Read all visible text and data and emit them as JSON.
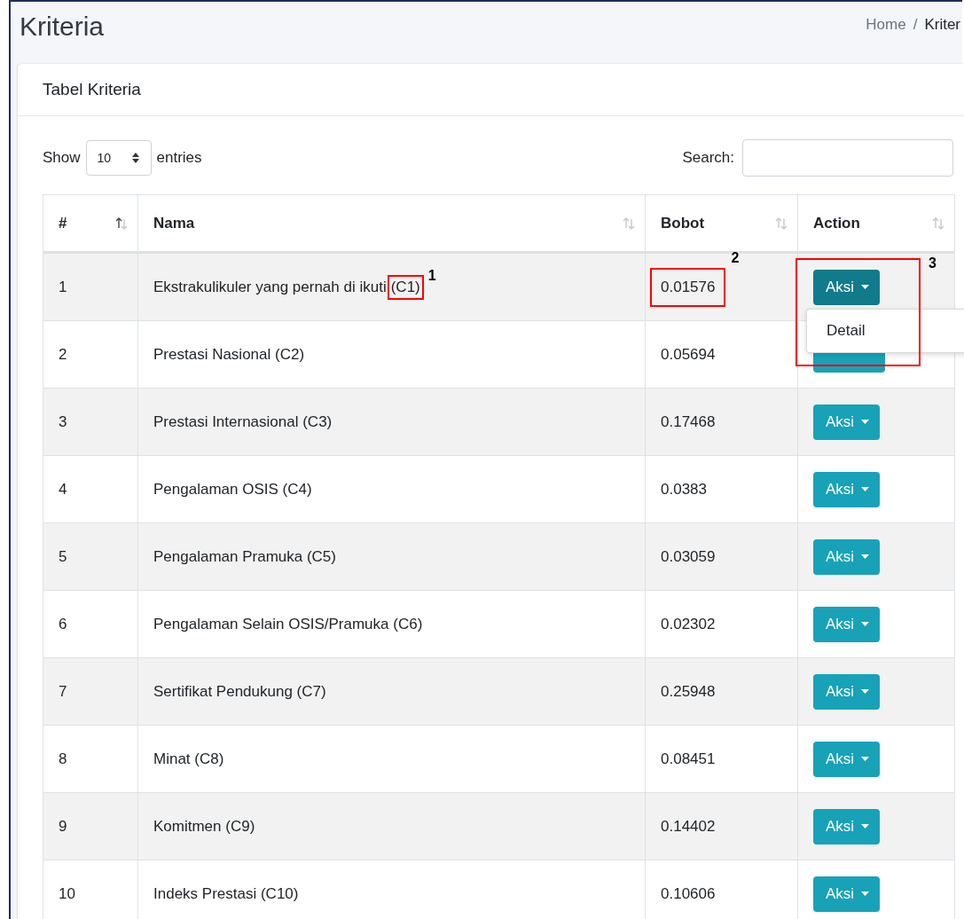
{
  "page": {
    "title": "Kriteria",
    "breadcrumb": [
      {
        "label": "Home",
        "active": false
      },
      {
        "label": "Kriter",
        "active": true
      }
    ],
    "separator": "/"
  },
  "card": {
    "title": "Tabel Kriteria"
  },
  "length_control": {
    "before": "Show",
    "value": "10",
    "after": "entries"
  },
  "search": {
    "label": "Search:"
  },
  "table": {
    "columns": [
      {
        "label": "#",
        "sorted": true
      },
      {
        "label": "Nama",
        "sorted": false
      },
      {
        "label": "Bobot",
        "sorted": false
      },
      {
        "label": "Action",
        "sorted": false
      }
    ],
    "rows": [
      {
        "no": "1",
        "name": "Ekstrakulikuler yang pernah di ikuti",
        "boxed_code": "(C1)",
        "bobot": "0.01576",
        "action": "Aksi",
        "expanded": true,
        "menu": [
          "Detail"
        ],
        "code_callout": "1",
        "bobot_callout": "2",
        "action_callout": "3"
      },
      {
        "no": "2",
        "name": "Prestasi Nasional (C2)",
        "bobot": "0.05694",
        "expanded": false
      },
      {
        "no": "3",
        "name": "Prestasi Internasional (C3)",
        "bobot": "0.17468",
        "action": "Aksi",
        "expanded": false
      },
      {
        "no": "4",
        "name": "Pengalaman OSIS (C4)",
        "bobot": "0.0383",
        "action": "Aksi",
        "expanded": false
      },
      {
        "no": "5",
        "name": "Pengalaman Pramuka (C5)",
        "bobot": "0.03059",
        "action": "Aksi",
        "expanded": false
      },
      {
        "no": "6",
        "name": "Pengalaman Selain OSIS/Pramuka (C6)",
        "bobot": "0.02302",
        "action": "Aksi",
        "expanded": false
      },
      {
        "no": "7",
        "name": "Sertifikat Pendukung (C7)",
        "bobot": "0.25948",
        "action": "Aksi",
        "expanded": false
      },
      {
        "no": "8",
        "name": "Minat (C8)",
        "bobot": "0.08451",
        "action": "Aksi",
        "expanded": false
      },
      {
        "no": "9",
        "name": "Komitmen (C9)",
        "bobot": "0.14402",
        "action": "Aksi",
        "expanded": false
      },
      {
        "no": "10",
        "name": "Indeks Prestasi (C10)",
        "bobot": "0.10606",
        "action": "Aksi",
        "expanded": false
      }
    ]
  }
}
